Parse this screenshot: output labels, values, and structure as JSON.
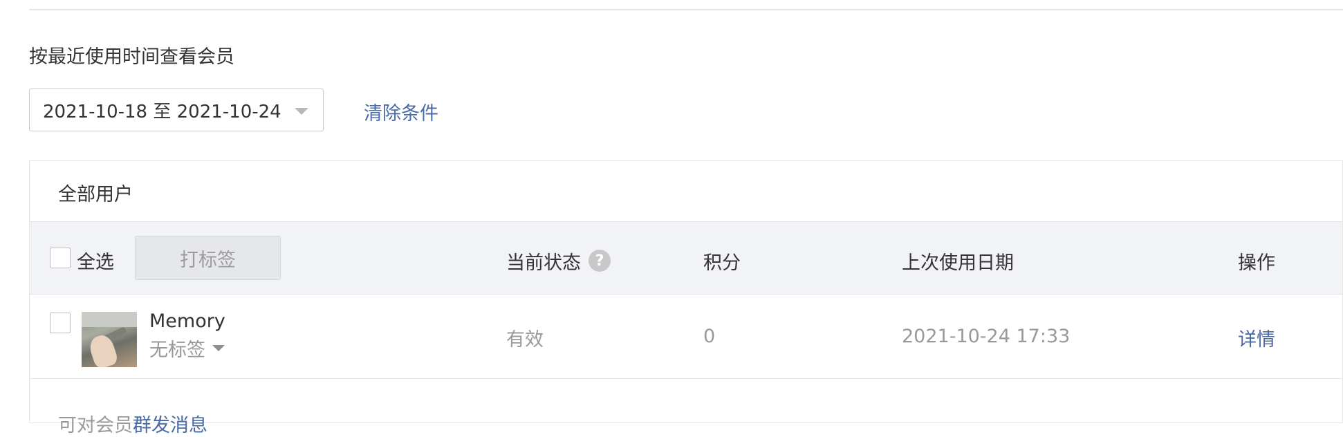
{
  "filter": {
    "label": "按最近使用时间查看会员",
    "date_range": "2021-10-18 至 2021-10-24",
    "clear_label": "清除条件"
  },
  "panel": {
    "title": "全部用户",
    "header": {
      "select_all": "全选",
      "tag_button": "打标签",
      "status": "当前状态",
      "points": "积分",
      "last_used": "上次使用日期",
      "actions": "操作"
    },
    "rows": [
      {
        "name": "Memory",
        "tag": "无标签",
        "status": "有效",
        "points": "0",
        "last_used": "2021-10-24 17:33",
        "action": "详情"
      }
    ],
    "footer": {
      "prefix": "可对会员",
      "link": "群发消息"
    }
  },
  "icons": {
    "help": "?"
  },
  "colors": {
    "link": "#4a6aa5",
    "header_bg": "#f2f3f7",
    "muted_text": "#999999"
  }
}
